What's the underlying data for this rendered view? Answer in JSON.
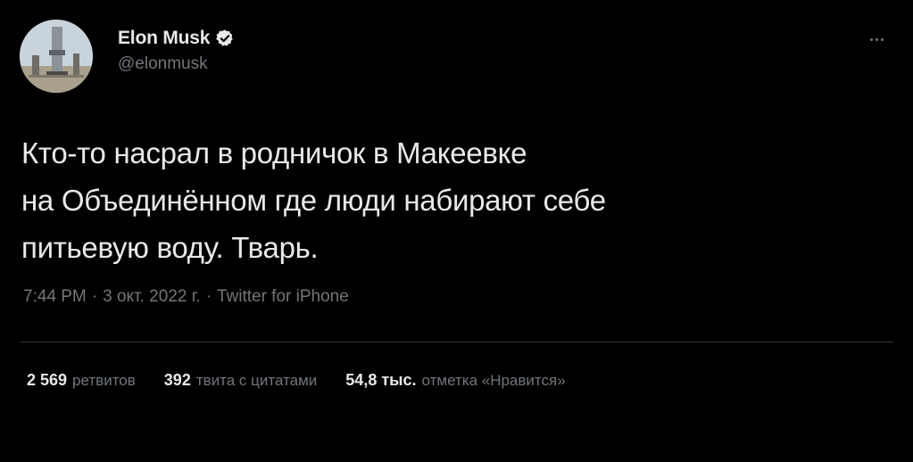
{
  "author": {
    "display_name": "Elon Musk",
    "handle": "@elonmusk",
    "verified": true,
    "verified_color": "#1d9bf0"
  },
  "tweet": {
    "text_lines": [
      "Кто-то насрал в родничок в Макеевке",
      "на Объединённом где люди набирают себе",
      "питьевую воду. Тварь."
    ],
    "time": "7:44 PM",
    "date": "3 окт. 2022 г.",
    "source": "Twitter for iPhone",
    "separator": "·"
  },
  "stats": {
    "retweets": {
      "count": "2 569",
      "label": "ретвитов"
    },
    "quotes": {
      "count": "392",
      "label": "твита с цитатами"
    },
    "likes": {
      "count": "54,8 тыс.",
      "label": "отметка «Нравится»"
    }
  },
  "icons": {
    "avatar": "avatar-image",
    "verified": "verified-badge-icon",
    "more": "more-options-icon"
  }
}
